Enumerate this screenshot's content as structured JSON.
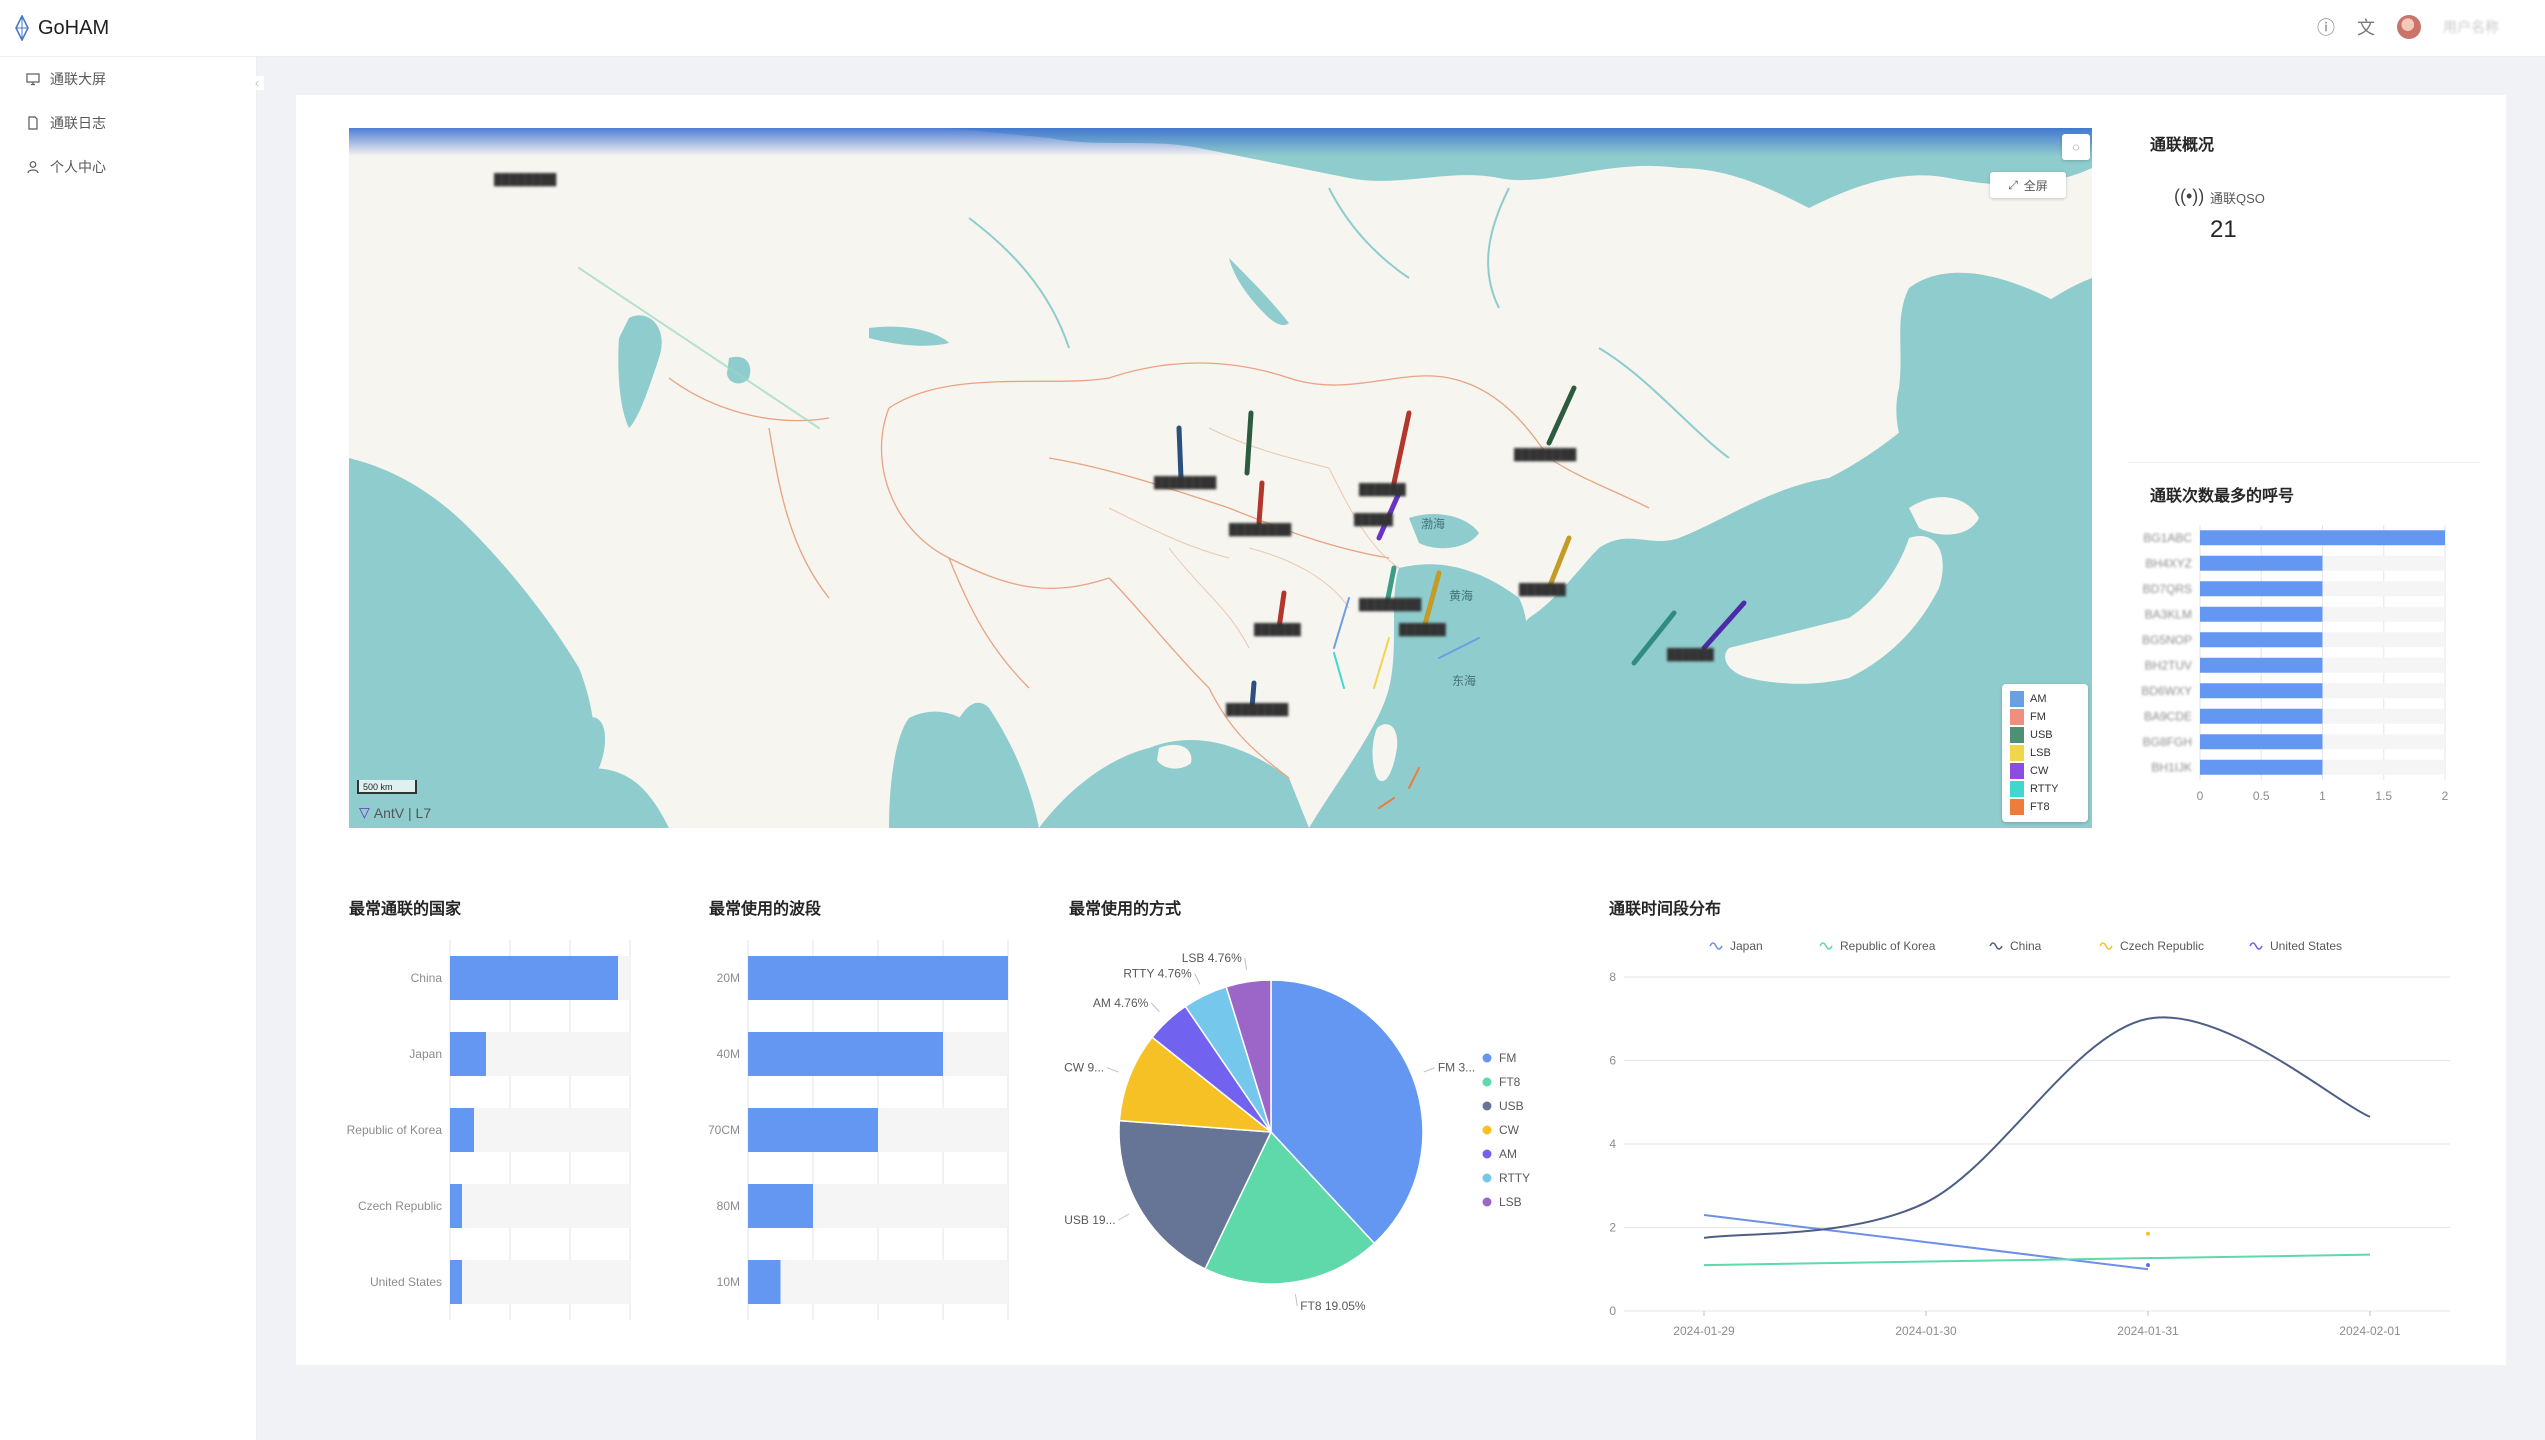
{
  "app": {
    "title": "GoHAM"
  },
  "header": {
    "help_icon": "question-circle-icon",
    "translate_icon": "translate-icon",
    "username": "用户名称"
  },
  "sidebar": {
    "collapse_glyph": "‹",
    "items": [
      {
        "label": "通联大屏",
        "icon": "monitor-icon"
      },
      {
        "label": "通联日志",
        "icon": "file-icon"
      },
      {
        "label": "个人中心",
        "icon": "user-icon"
      }
    ]
  },
  "map": {
    "fullscreen_label": "全屏",
    "scale_label": "500 km",
    "attribution": "AntV | L7",
    "sea_labels": [
      "渤海",
      "黄海",
      "东海"
    ],
    "legend": [
      {
        "name": "AM",
        "color": "#6a9fe4"
      },
      {
        "name": "FM",
        "color": "#f08f7d"
      },
      {
        "name": "USB",
        "color": "#4e8f75"
      },
      {
        "name": "LSB",
        "color": "#f1d54a"
      },
      {
        "name": "CW",
        "color": "#8a4fe0"
      },
      {
        "name": "RTTY",
        "color": "#40d6d1"
      },
      {
        "name": "FT8",
        "color": "#f07c3c"
      }
    ]
  },
  "overview": {
    "title": "通联概况",
    "qso_label": "通联QSO",
    "qso_value": "21",
    "qso_icon": "antenna-icon"
  },
  "titles": {
    "top_callsigns": "通联次数最多的呼号",
    "countries": "最常通联的国家",
    "bands": "最常使用的波段",
    "modes": "最常使用的方式",
    "timeline": "通联时间段分布"
  },
  "chart_data": [
    {
      "id": "top_callsigns",
      "type": "bar",
      "orientation": "horizontal",
      "categories": [
        "BG1ABC",
        "BH4XYZ",
        "BD7QRS",
        "BA3KLM",
        "BG5NOP",
        "BH2TUV",
        "BD6WXY",
        "BA9CDE",
        "BG8FGH",
        "BH1IJK"
      ],
      "values": [
        2,
        1,
        1,
        1,
        1,
        1,
        1,
        1,
        1,
        1
      ],
      "xlim": [
        0,
        2
      ],
      "ticks": [
        "0",
        "0.5",
        "1",
        "1.5",
        "2"
      ],
      "color": "#6497f2"
    },
    {
      "id": "countries",
      "type": "bar",
      "orientation": "horizontal",
      "categories": [
        "China",
        "Japan",
        "Republic of Korea",
        "Czech Republic",
        "United States"
      ],
      "values": [
        14,
        3,
        2,
        1,
        1
      ],
      "xlim": [
        0,
        15
      ],
      "ticks": [
        "0",
        "5",
        "10",
        "15"
      ],
      "color": "#6497f2"
    },
    {
      "id": "bands",
      "type": "bar",
      "orientation": "horizontal",
      "categories": [
        "20M",
        "40M",
        "70CM",
        "80M",
        "10M"
      ],
      "values": [
        8,
        6,
        4,
        2,
        1
      ],
      "xlim": [
        0,
        8
      ],
      "ticks": [
        "0",
        "2",
        "4",
        "6",
        "8"
      ],
      "color": "#6497f2"
    },
    {
      "id": "modes",
      "type": "pie",
      "slices": [
        {
          "name": "FM",
          "value": 8,
          "color": "#6497f2",
          "label": "FM 3..."
        },
        {
          "name": "FT8",
          "value": 4,
          "color": "#5fd9a9",
          "label": "FT8 19.05%"
        },
        {
          "name": "USB",
          "value": 4,
          "color": "#667595",
          "label": "USB 19..."
        },
        {
          "name": "CW",
          "value": 2,
          "color": "#f5c125",
          "label": "CW 9..."
        },
        {
          "name": "AM",
          "value": 1,
          "color": "#7162f0",
          "label": "AM 4.76%"
        },
        {
          "name": "RTTY",
          "value": 1,
          "color": "#75c7ec",
          "label": "RTTY 4.76%"
        },
        {
          "name": "LSB",
          "value": 1,
          "color": "#9c66c9",
          "label": "LSB 4.76%"
        }
      ]
    },
    {
      "id": "timeline",
      "type": "line",
      "x": [
        "2024-01-29",
        "2024-01-30",
        "2024-01-31",
        "2024-02-01"
      ],
      "ylim": [
        0,
        8
      ],
      "yticks": [
        "0",
        "2",
        "4",
        "6",
        "8"
      ],
      "series": [
        {
          "name": "Japan",
          "color": "#6d8fe8",
          "values": [
            2.3,
            null,
            1,
            null
          ]
        },
        {
          "name": "Republic of Korea",
          "color": "#5fd9a9",
          "values": [
            1.1,
            null,
            null,
            1.35
          ]
        },
        {
          "name": "China",
          "color": "#4e5f86",
          "values": [
            1.75,
            2.6,
            7,
            4.65
          ]
        },
        {
          "name": "Czech Republic",
          "color": "#f5c125",
          "values": [
            null,
            null,
            1.85,
            null
          ]
        },
        {
          "name": "United States",
          "color": "#6d63e6",
          "values": [
            null,
            null,
            1.1,
            null
          ]
        }
      ]
    }
  ]
}
